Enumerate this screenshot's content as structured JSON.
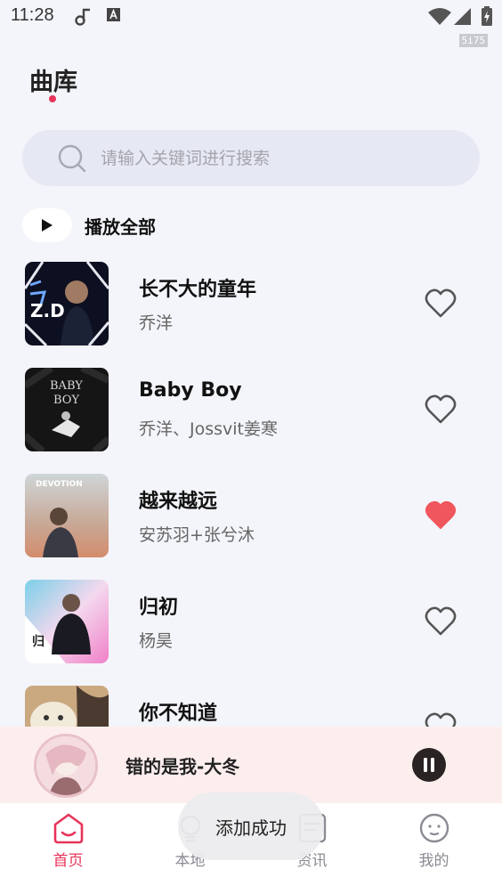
{
  "status_bar": {
    "time": "11:28",
    "fps": "5i75"
  },
  "page": {
    "title": "曲库"
  },
  "search": {
    "placeholder": "请输入关键词进行搜索"
  },
  "play_all": {
    "label": "播放全部"
  },
  "songs": [
    {
      "title": "长不大的童年",
      "artist": "乔洋",
      "favorited": false
    },
    {
      "title": "Baby Boy",
      "artist": "乔洋、Jossvit姜寒",
      "favorited": true,
      "_note": ""
    },
    {
      "title": "越来越远",
      "artist": "安苏羽+张兮沐",
      "favorited": true
    },
    {
      "title": "归初",
      "artist": "杨昊",
      "favorited": false
    },
    {
      "title": "你不知道",
      "artist": "",
      "favorited": false
    }
  ],
  "player": {
    "now_playing": "错的是我-大冬",
    "state": "playing"
  },
  "nav": [
    {
      "label": "首页",
      "icon": "home-icon",
      "active": true
    },
    {
      "label": "本地",
      "icon": "bulb-icon",
      "active": false
    },
    {
      "label": "资讯",
      "icon": "news-icon",
      "active": false
    },
    {
      "label": "我的",
      "icon": "profile-icon",
      "active": false
    }
  ],
  "toast": {
    "message": "添加成功"
  },
  "colors": {
    "accent": "#e8345a",
    "favorite": "#f0575d",
    "background": "#f4f5fa"
  }
}
